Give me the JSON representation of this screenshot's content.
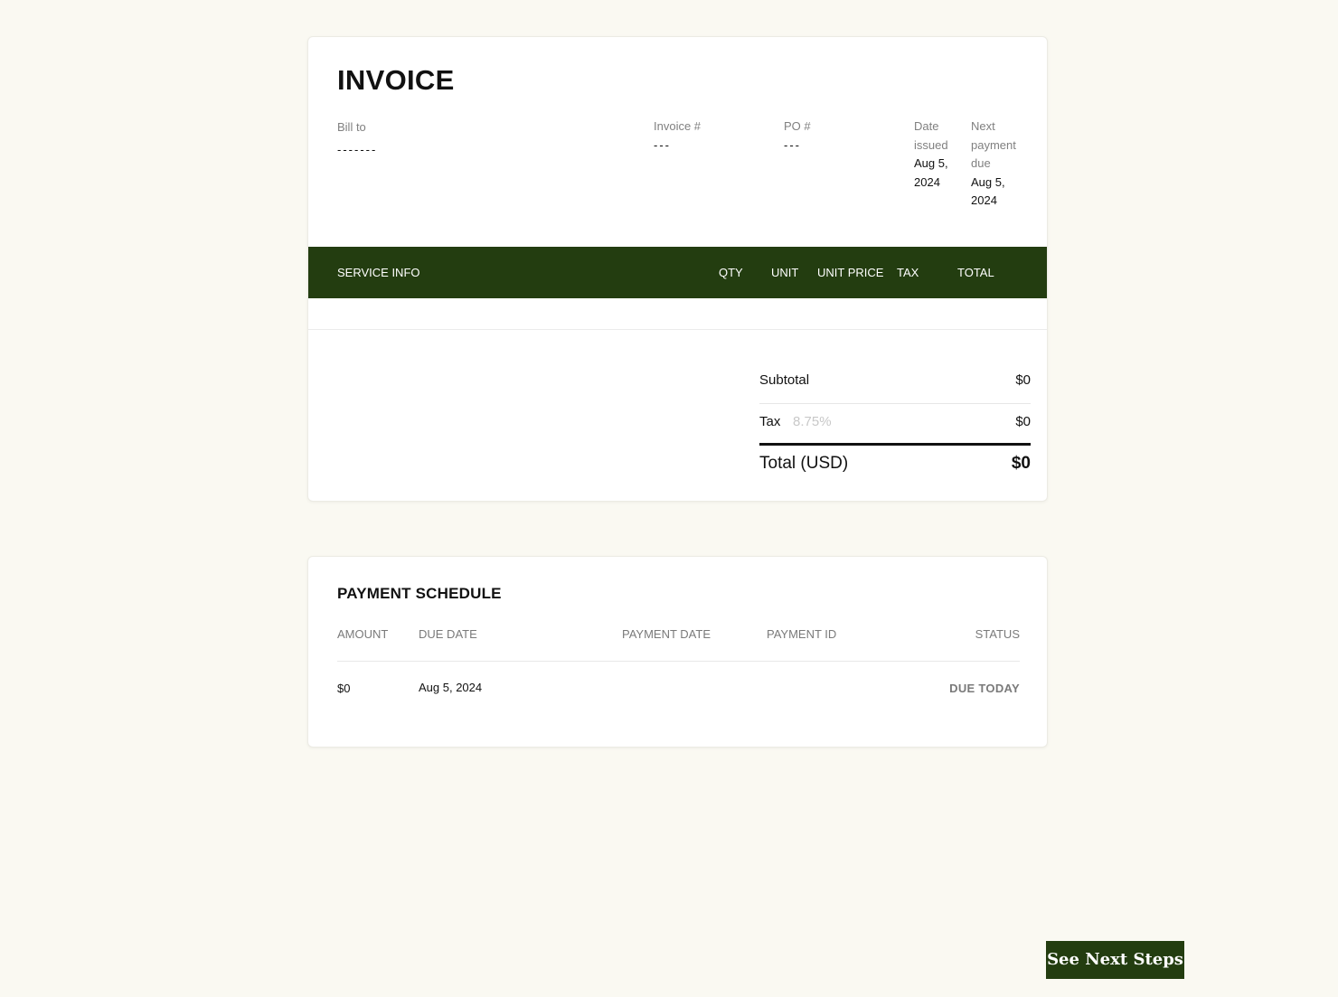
{
  "invoice": {
    "title": "INVOICE",
    "bill_to_label": "Bill to",
    "bill_to_value": "-------",
    "invoice_number_label": "Invoice #",
    "invoice_number_value": "---",
    "po_label": "PO #",
    "po_value": "---",
    "date_issued_label": "Date issued",
    "date_issued_value": "Aug 5, 2024",
    "next_payment_label": "Next payment due",
    "next_payment_value": "Aug 5, 2024"
  },
  "service_table": {
    "columns": {
      "service_info": "SERVICE INFO",
      "qty": "QTY",
      "unit": "UNIT",
      "unit_price": "UNIT PRICE",
      "tax": "TAX",
      "total": "TOTAL"
    }
  },
  "totals": {
    "subtotal_label": "Subtotal",
    "subtotal_value": "$0",
    "tax_label": "Tax",
    "tax_rate": "8.75%",
    "tax_value": "$0",
    "total_label": "Total (USD)",
    "total_value": "$0"
  },
  "payment_schedule": {
    "title": "PAYMENT SCHEDULE",
    "columns": {
      "amount": "AMOUNT",
      "due_date": "DUE DATE",
      "payment_date": "PAYMENT DATE",
      "payment_id": "PAYMENT ID",
      "status": "STATUS"
    },
    "rows": [
      {
        "amount": "$0",
        "due_date": "Aug 5, 2024",
        "payment_date": "",
        "payment_id": "",
        "status": "DUE TODAY"
      }
    ]
  },
  "actions": {
    "next_steps_label": "See Next Steps"
  },
  "colors": {
    "brand_green": "#233d10",
    "page_background": "#faf9f2"
  }
}
